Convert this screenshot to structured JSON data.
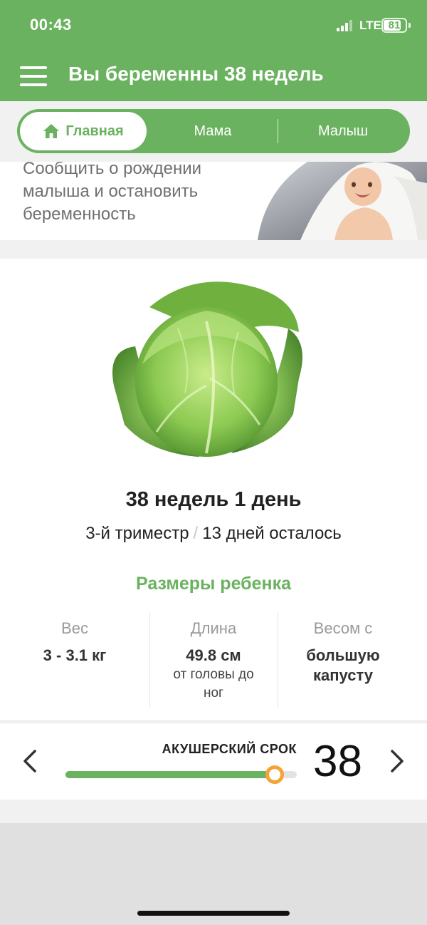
{
  "status_bar": {
    "time": "00:43",
    "network": "LTE",
    "battery": "81",
    "battery_level": 0.81
  },
  "header": {
    "title": "Вы беременны 38 недель",
    "menu_icon": "hamburger-icon"
  },
  "tabs": [
    {
      "label": "Главная",
      "icon": "home-icon",
      "active": true
    },
    {
      "label": "Мама",
      "active": false
    },
    {
      "label": "Малыш",
      "active": false
    }
  ],
  "banner": {
    "text": "Сообщить о рождении малыша и остановить беременность"
  },
  "week_info": {
    "title": "38 недель 1 день",
    "trimester": "3-й триместр",
    "separator": "/",
    "remaining": "13 дней осталось",
    "fruit_image": "cabbage"
  },
  "baby_size": {
    "title": "Размеры ребенка",
    "weight": {
      "label": "Вес",
      "value": "3 - 3.1 кг"
    },
    "length": {
      "label": "Длина",
      "value": "49.8 см",
      "note": "от головы до ног"
    },
    "comparison": {
      "label": "Весом с",
      "value": "большую капусту"
    }
  },
  "week_selector": {
    "label": "АКУШЕРСКИЙ СРОК",
    "week": "38",
    "progress": 0.905,
    "prev_icon": "chevron-left-icon",
    "next_icon": "chevron-right-icon"
  },
  "colors": {
    "accent": "#6ab25f",
    "knob": "#f5a236",
    "muted": "#9a9a9a"
  }
}
